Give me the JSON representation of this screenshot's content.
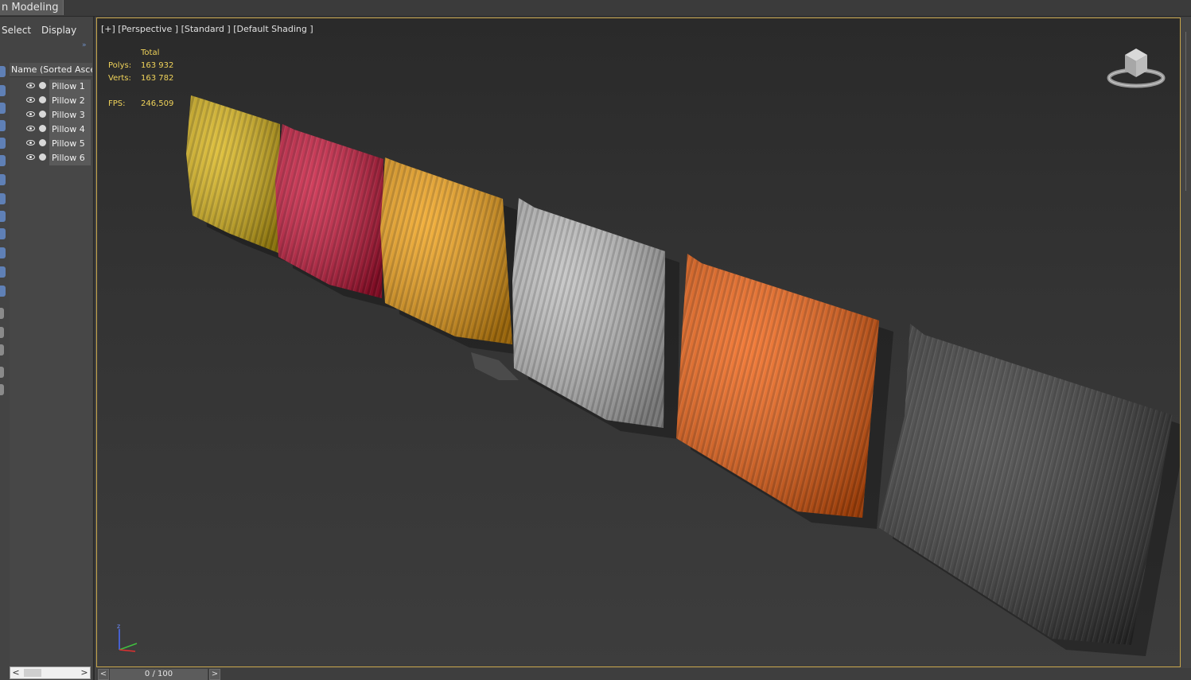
{
  "ribbon": {
    "tab_label": "n Modeling"
  },
  "explorer": {
    "menu": {
      "select": "Select",
      "display": "Display"
    },
    "expand_glyph": "»",
    "column_header": "Name (Sorted Ascending)",
    "items": [
      {
        "label": "Pillow 1"
      },
      {
        "label": "Pillow 2"
      },
      {
        "label": "Pillow 3"
      },
      {
        "label": "Pillow 4"
      },
      {
        "label": "Pillow 5"
      },
      {
        "label": "Pillow 6"
      }
    ],
    "scroll_left": "<",
    "scroll_right": ">"
  },
  "viewport": {
    "label": "[+] [Perspective ] [Standard ] [Default Shading ]",
    "stats": {
      "header": "Total",
      "polys_label": "Polys:",
      "polys_value": "163 932",
      "verts_label": "Verts:",
      "verts_value": "163 782",
      "fps_label": "FPS:",
      "fps_value": "246,509"
    },
    "pillow_colors": [
      "#d9b417",
      "#c8163a",
      "#f0a015",
      "#bdbdbd",
      "#f06010",
      "#3a3a3a"
    ],
    "accent_border": "#c7a54b",
    "axis_label": "z"
  },
  "timeslider": {
    "frame": "0 / 100",
    "prev": "<",
    "next": ">"
  }
}
